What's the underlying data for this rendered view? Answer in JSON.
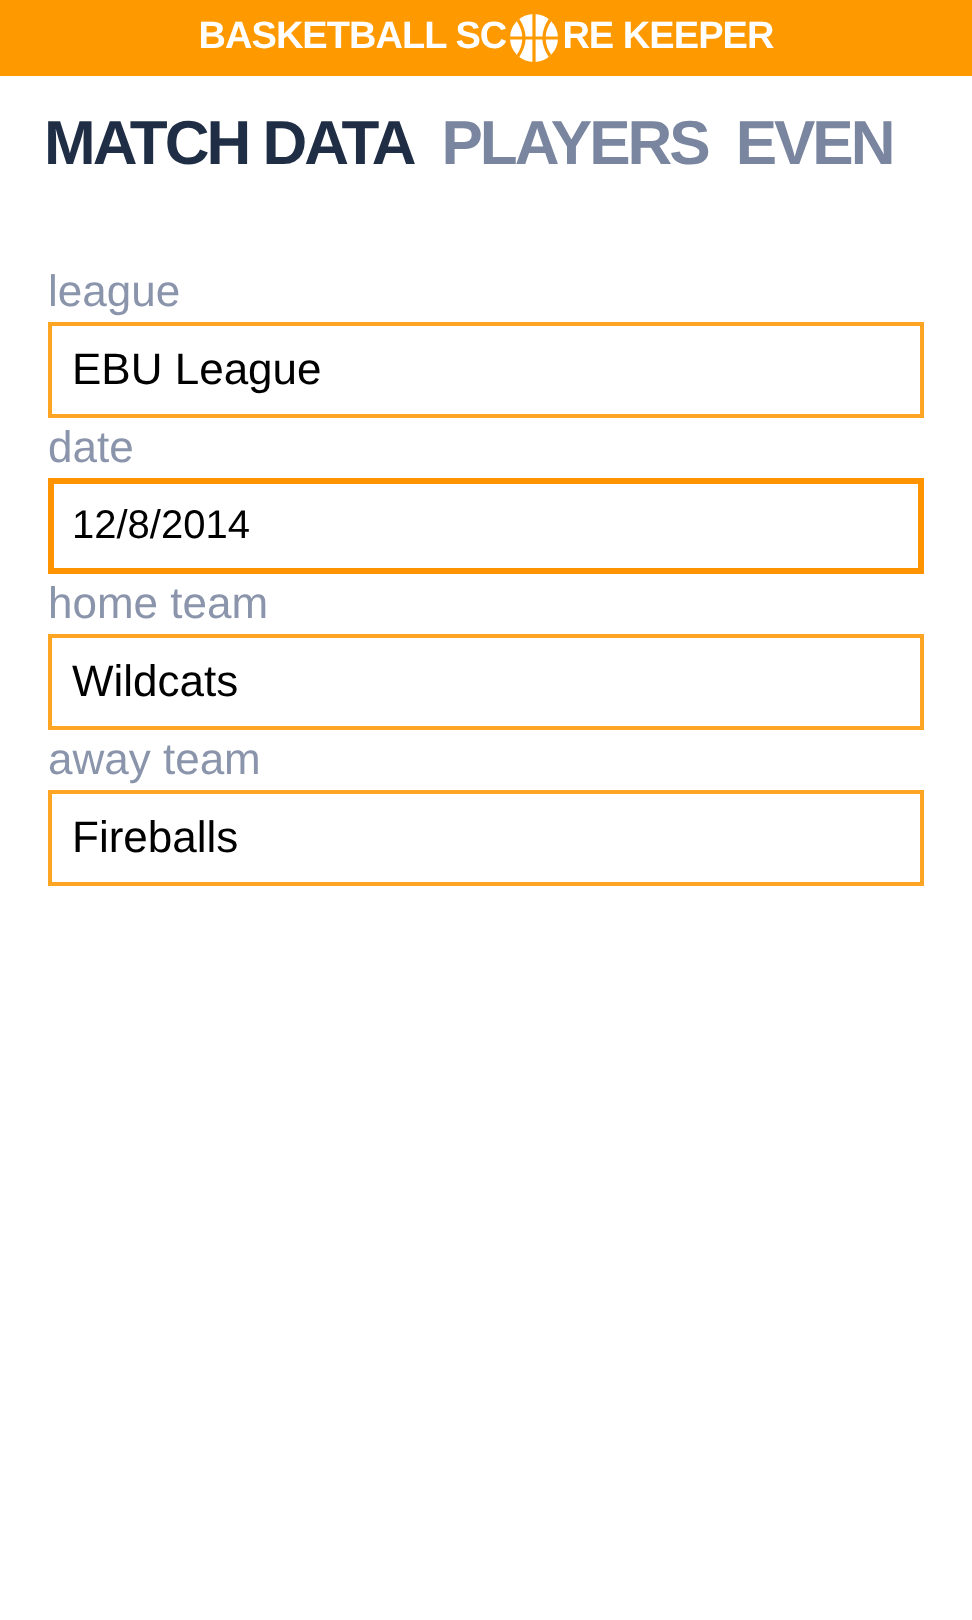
{
  "header": {
    "logo_before": "BASKETBALL SC",
    "logo_after": "RE KEEPER"
  },
  "tabs": [
    {
      "label": "MATCH DATA",
      "selected": true
    },
    {
      "label": "PLAYERS",
      "selected": false
    },
    {
      "label": "EVEN",
      "selected": false
    }
  ],
  "fields": [
    {
      "label": "league",
      "kind": "text",
      "value": "EBU League"
    },
    {
      "label": "date",
      "kind": "date",
      "value": "12/8/2014"
    },
    {
      "label": "home team",
      "kind": "text",
      "value": "Wildcats"
    },
    {
      "label": "away team",
      "kind": "text",
      "value": "Fireballs"
    }
  ]
}
